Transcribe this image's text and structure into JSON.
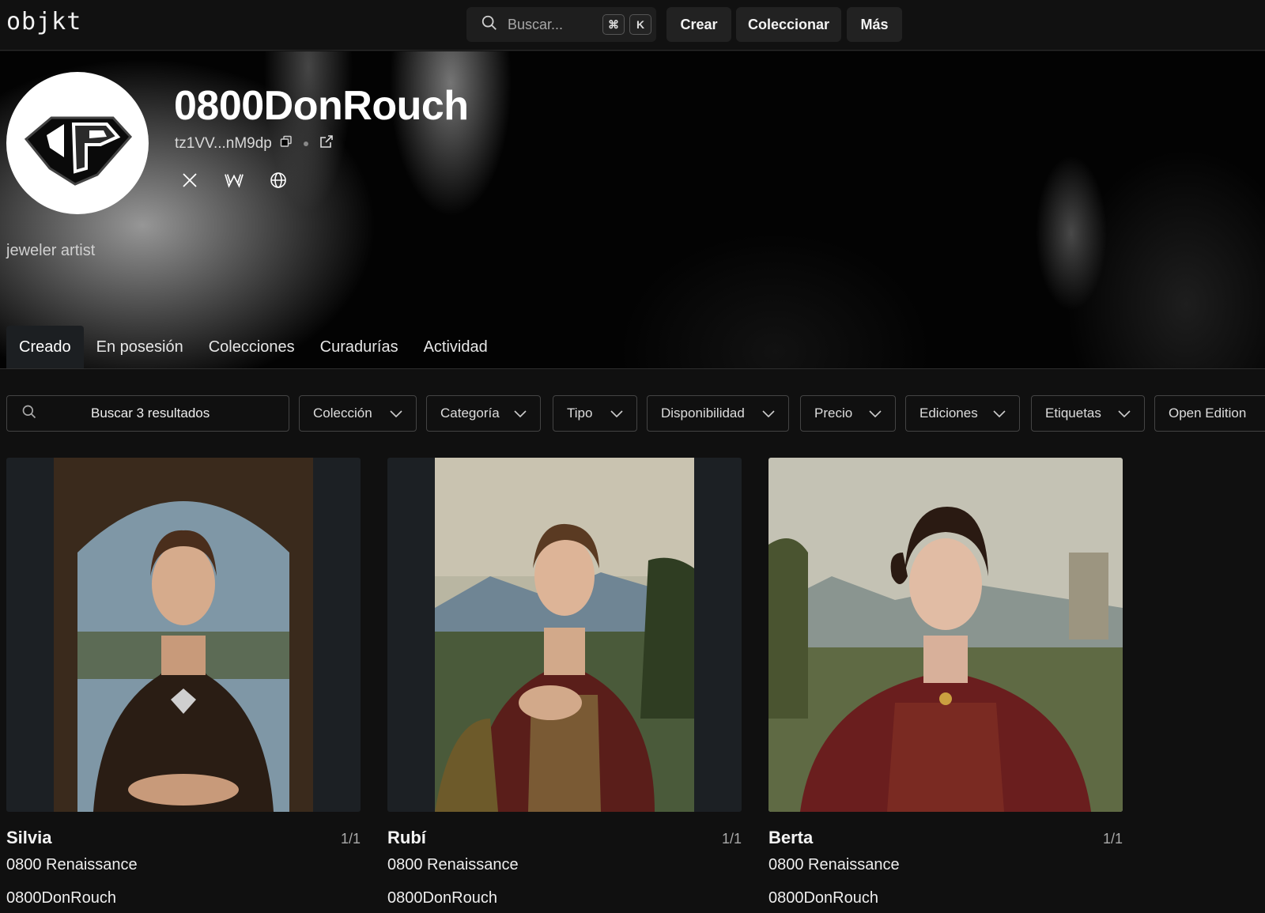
{
  "header": {
    "logo": "objkt",
    "search_placeholder": "Buscar...",
    "kbd_cmd": "⌘",
    "kbd_k": "K",
    "nav": [
      "Crear",
      "Coleccionar",
      "Más"
    ]
  },
  "profile": {
    "name": "0800DonRouch",
    "address": "tz1VV...nM9dp",
    "bio": "jeweler artist",
    "socials": [
      "x-icon",
      "w-icon",
      "globe-icon"
    ]
  },
  "tabs": [
    "Creado",
    "En posesión",
    "Colecciones",
    "Curadurías",
    "Actividad"
  ],
  "active_tab": "Creado",
  "filters": {
    "search_label": "Buscar 3 resultados",
    "buttons": [
      "Colección",
      "Categoría",
      "Tipo",
      "Disponibilidad",
      "Precio",
      "Ediciones",
      "Etiquetas",
      "Open Edition"
    ]
  },
  "cards": [
    {
      "title": "Silvia",
      "edition": "1/1",
      "collection": "0800 Renaissance",
      "artist": "0800DonRouch"
    },
    {
      "title": "Rubí",
      "edition": "1/1",
      "collection": "0800 Renaissance",
      "artist": "0800DonRouch"
    },
    {
      "title": "Berta",
      "edition": "1/1",
      "collection": "0800 Renaissance",
      "artist": "0800DonRouch"
    }
  ],
  "colors": {
    "background": "#101010",
    "topbar": "#111111",
    "button": "#222222",
    "border": "#444444"
  }
}
